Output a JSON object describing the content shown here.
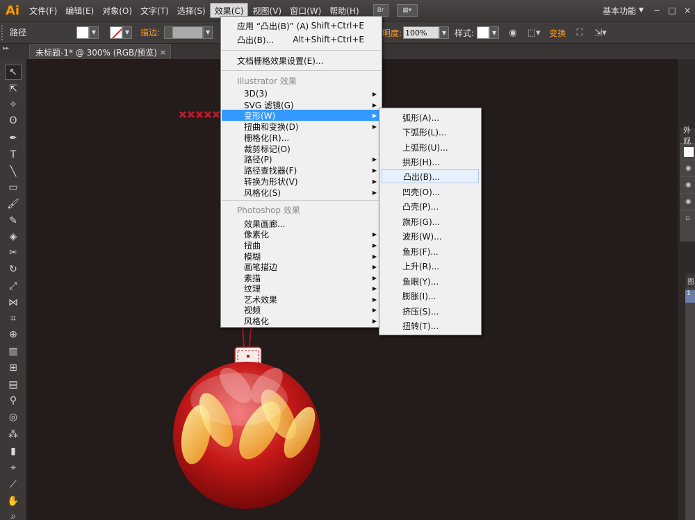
{
  "app": {
    "logo": "Ai",
    "workspace": "基本功能"
  },
  "menubar": {
    "items": [
      {
        "label": "文件(F)"
      },
      {
        "label": "编辑(E)"
      },
      {
        "label": "对象(O)"
      },
      {
        "label": "文字(T)"
      },
      {
        "label": "选择(S)"
      },
      {
        "label": "效果(C)"
      },
      {
        "label": "视图(V)"
      },
      {
        "label": "窗口(W)"
      },
      {
        "label": "帮助(H)"
      }
    ],
    "bridge_icon": "Br",
    "window_controls": [
      "−",
      "□",
      "×"
    ]
  },
  "controlbar": {
    "path_label": "路径",
    "stroke_label": "描边:",
    "opacity_label": "明度:",
    "opacity_value": "100%",
    "style_label": "样式:",
    "transform_label": "变换"
  },
  "tab": {
    "title": "未标题-1* @ 300% (RGB/预览)",
    "close": "×"
  },
  "effects_menu": {
    "apply_last": "应用 “凸出(B)” (A)",
    "apply_last_shortcut": "Shift+Ctrl+E",
    "last_effect": "凸出(B)...",
    "last_effect_shortcut": "Alt+Shift+Ctrl+E",
    "document_raster": "文档栅格效果设置(E)...",
    "illustrator_header": "Illustrator 效果",
    "illustrator_items": [
      "3D(3)",
      "SVG 滤镜(G)",
      "变形(W)",
      "扭曲和变换(D)",
      "栅格化(R)...",
      "裁剪标记(O)",
      "路径(P)",
      "路径查找器(F)",
      "转换为形状(V)",
      "风格化(S)"
    ],
    "photoshop_header": "Photoshop 效果",
    "photoshop_items": [
      "效果画廊...",
      "像素化",
      "扭曲",
      "模糊",
      "画笔描边",
      "素描",
      "纹理",
      "艺术效果",
      "视频",
      "风格化"
    ]
  },
  "warp_menu": {
    "items": [
      "弧形(A)...",
      "下弧形(L)...",
      "上弧形(U)...",
      "拱形(H)...",
      "凸出(B)...",
      "凹壳(O)...",
      "凸壳(P)...",
      "旗形(G)...",
      "波形(W)...",
      "鱼形(F)...",
      "上升(R)...",
      "鱼眼(Y)...",
      "膨胀(I)...",
      "挤压(S)...",
      "扭转(T)..."
    ]
  },
  "panels": {
    "appearance_tab": "外观",
    "layers_tab": "图"
  },
  "colors": {
    "accent": "#3399ff",
    "orange": "#f29a28",
    "canvas": "#241b1b"
  }
}
